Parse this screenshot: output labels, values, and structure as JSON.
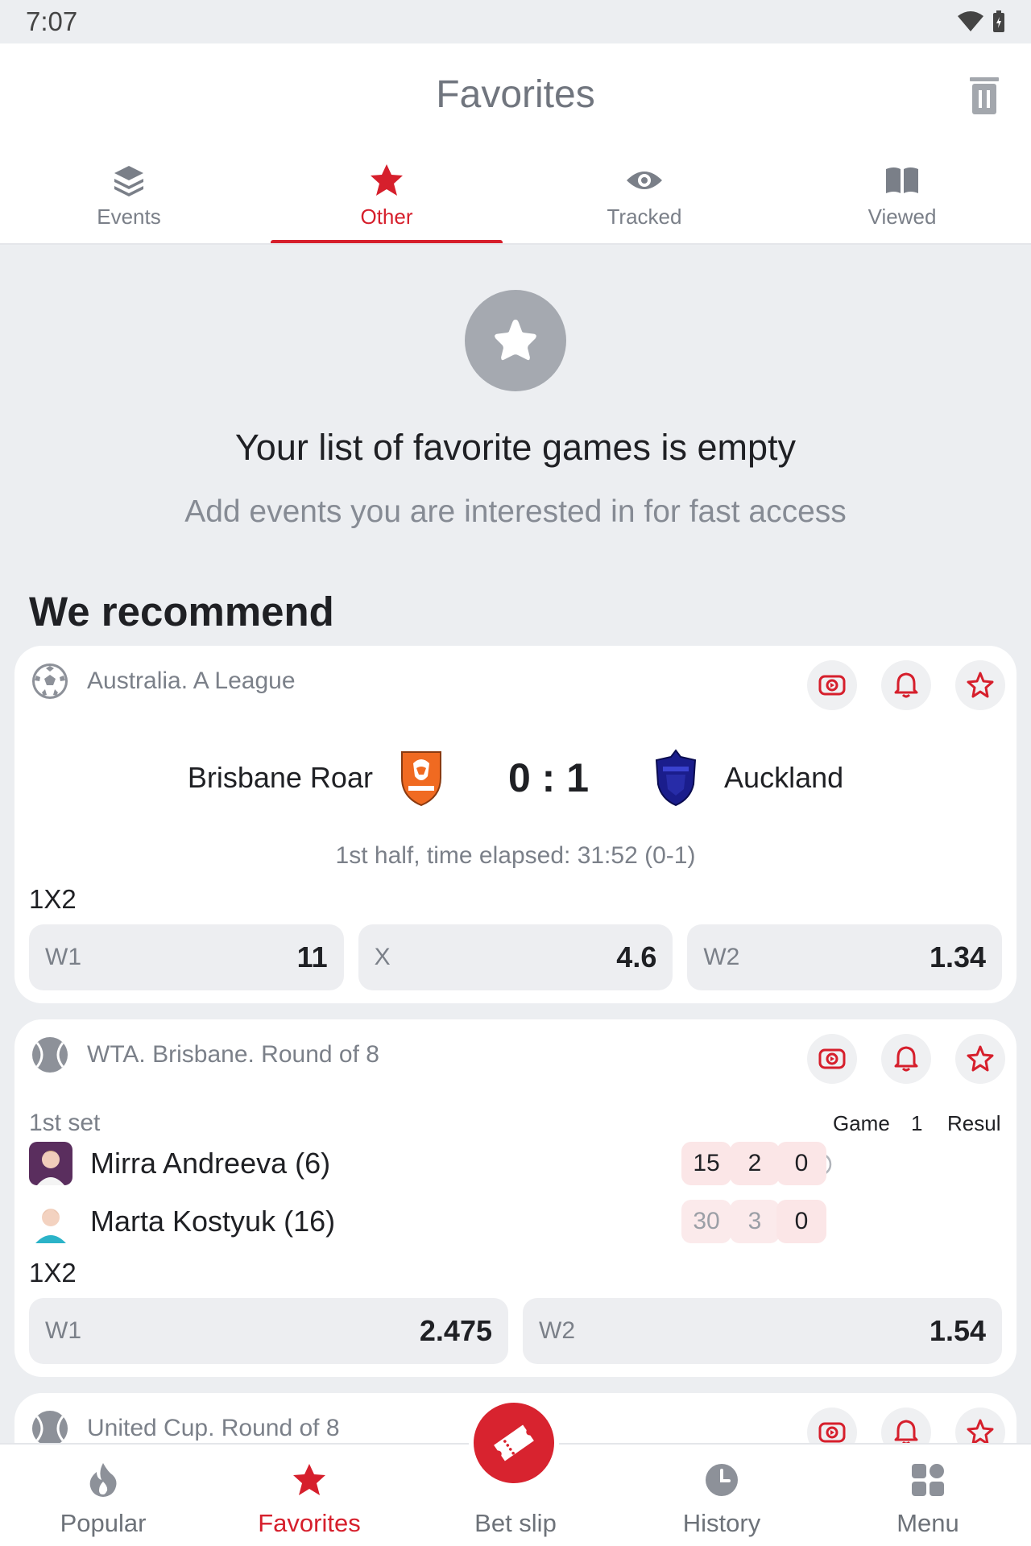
{
  "status_bar": {
    "time": "7:07"
  },
  "header": {
    "title": "Favorites"
  },
  "tabs": [
    {
      "label": "Events",
      "icon": "layers-icon",
      "active": false
    },
    {
      "label": "Other",
      "icon": "star-icon",
      "active": true
    },
    {
      "label": "Tracked",
      "icon": "eye-icon",
      "active": false
    },
    {
      "label": "Viewed",
      "icon": "book-icon",
      "active": false
    }
  ],
  "empty_state": {
    "title": "Your list of favorite games is empty",
    "subtitle": "Add events you are interested in for fast access"
  },
  "recommend": {
    "heading": "We recommend"
  },
  "cards": [
    {
      "league": "Australia. A League",
      "sport_icon": "soccer-ball-icon",
      "team1": "Brisbane Roar",
      "team2": "Auckland",
      "score": "0 : 1",
      "period": "1st half, time elapsed: 31:52 (0-1)",
      "market": "1X2",
      "odds": [
        {
          "label": "W1",
          "value": "11"
        },
        {
          "label": "X",
          "value": "4.6"
        },
        {
          "label": "W2",
          "value": "1.34"
        }
      ]
    },
    {
      "league": "WTA. Brisbane. Round of 8",
      "sport_icon": "tennis-ball-icon",
      "set_label": "1st set",
      "headers": [
        "Game",
        "1",
        "Result"
      ],
      "players": [
        {
          "name": "Mirra Andreeva (6)",
          "scores": [
            "15",
            "2",
            "0"
          ],
          "serving": true
        },
        {
          "name": "Marta Kostyuk (16)",
          "scores": [
            "30",
            "3",
            "0"
          ],
          "serving": false
        }
      ],
      "market": "1X2",
      "odds": [
        {
          "label": "W1",
          "value": "2.475"
        },
        {
          "label": "W2",
          "value": "1.54"
        }
      ]
    },
    {
      "league": "United Cup. Round of 8",
      "sport_icon": "tennis-ball-icon"
    }
  ],
  "bottom_nav": [
    {
      "label": "Popular",
      "icon": "flame-icon",
      "active": false
    },
    {
      "label": "Favorites",
      "icon": "star-icon",
      "active": true
    },
    {
      "label": "Bet slip",
      "icon": "ticket-icon",
      "active": false
    },
    {
      "label": "History",
      "icon": "clock-icon",
      "active": false
    },
    {
      "label": "Menu",
      "icon": "grid-icon",
      "active": false
    }
  ],
  "colors": {
    "accent": "#d61f2c",
    "background": "#eceef1",
    "muted_text": "#7b8089"
  }
}
